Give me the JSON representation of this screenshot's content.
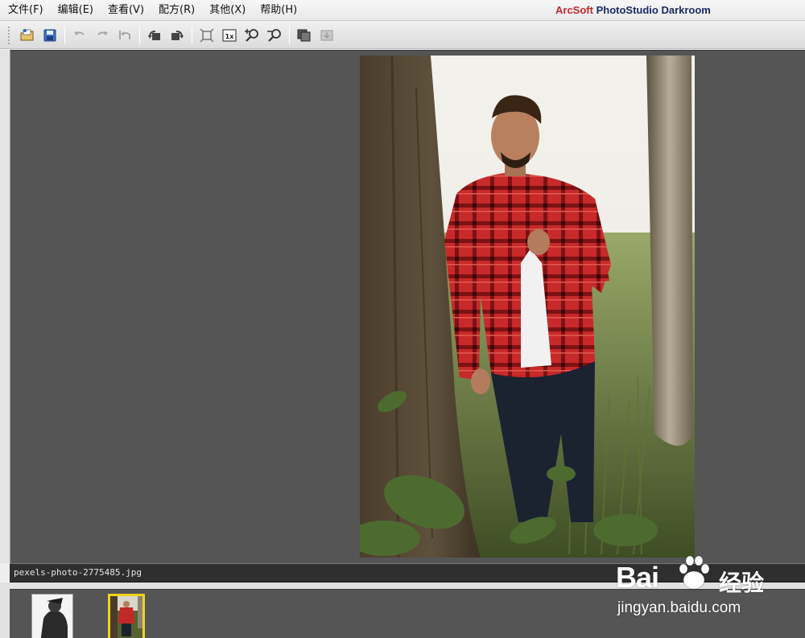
{
  "menubar": {
    "items": [
      {
        "label": "文件(F)"
      },
      {
        "label": "编辑(E)"
      },
      {
        "label": "查看(V)"
      },
      {
        "label": "配方(R)"
      },
      {
        "label": "其他(X)"
      },
      {
        "label": "帮助(H)"
      }
    ],
    "app_brand": "ArcSoft",
    "app_product": "PhotoStudio Darkroom",
    "accent_color": "#c0282d"
  },
  "toolbar": {
    "buttons": [
      {
        "icon": "open-folder-icon"
      },
      {
        "icon": "save-icon"
      },
      {
        "icon": "undo-icon"
      },
      {
        "icon": "redo-icon"
      },
      {
        "icon": "revert-icon"
      },
      {
        "icon": "rotate-left-icon"
      },
      {
        "icon": "rotate-right-icon"
      },
      {
        "icon": "fit-to-window-icon"
      },
      {
        "icon": "actual-size-icon",
        "label": "1x"
      },
      {
        "icon": "zoom-in-icon"
      },
      {
        "icon": "zoom-out-icon"
      },
      {
        "icon": "compare-icon"
      },
      {
        "icon": "export-icon"
      }
    ]
  },
  "viewer": {
    "background_color": "#555555"
  },
  "filebar": {
    "filename": "pexels-photo-2775485.jpg"
  },
  "thumbnails": {
    "selected_border_color": "#f1d21b"
  },
  "watermark": {
    "brand": "Bai",
    "brand_cn": "经验",
    "url": "jingyan.baidu.com"
  }
}
